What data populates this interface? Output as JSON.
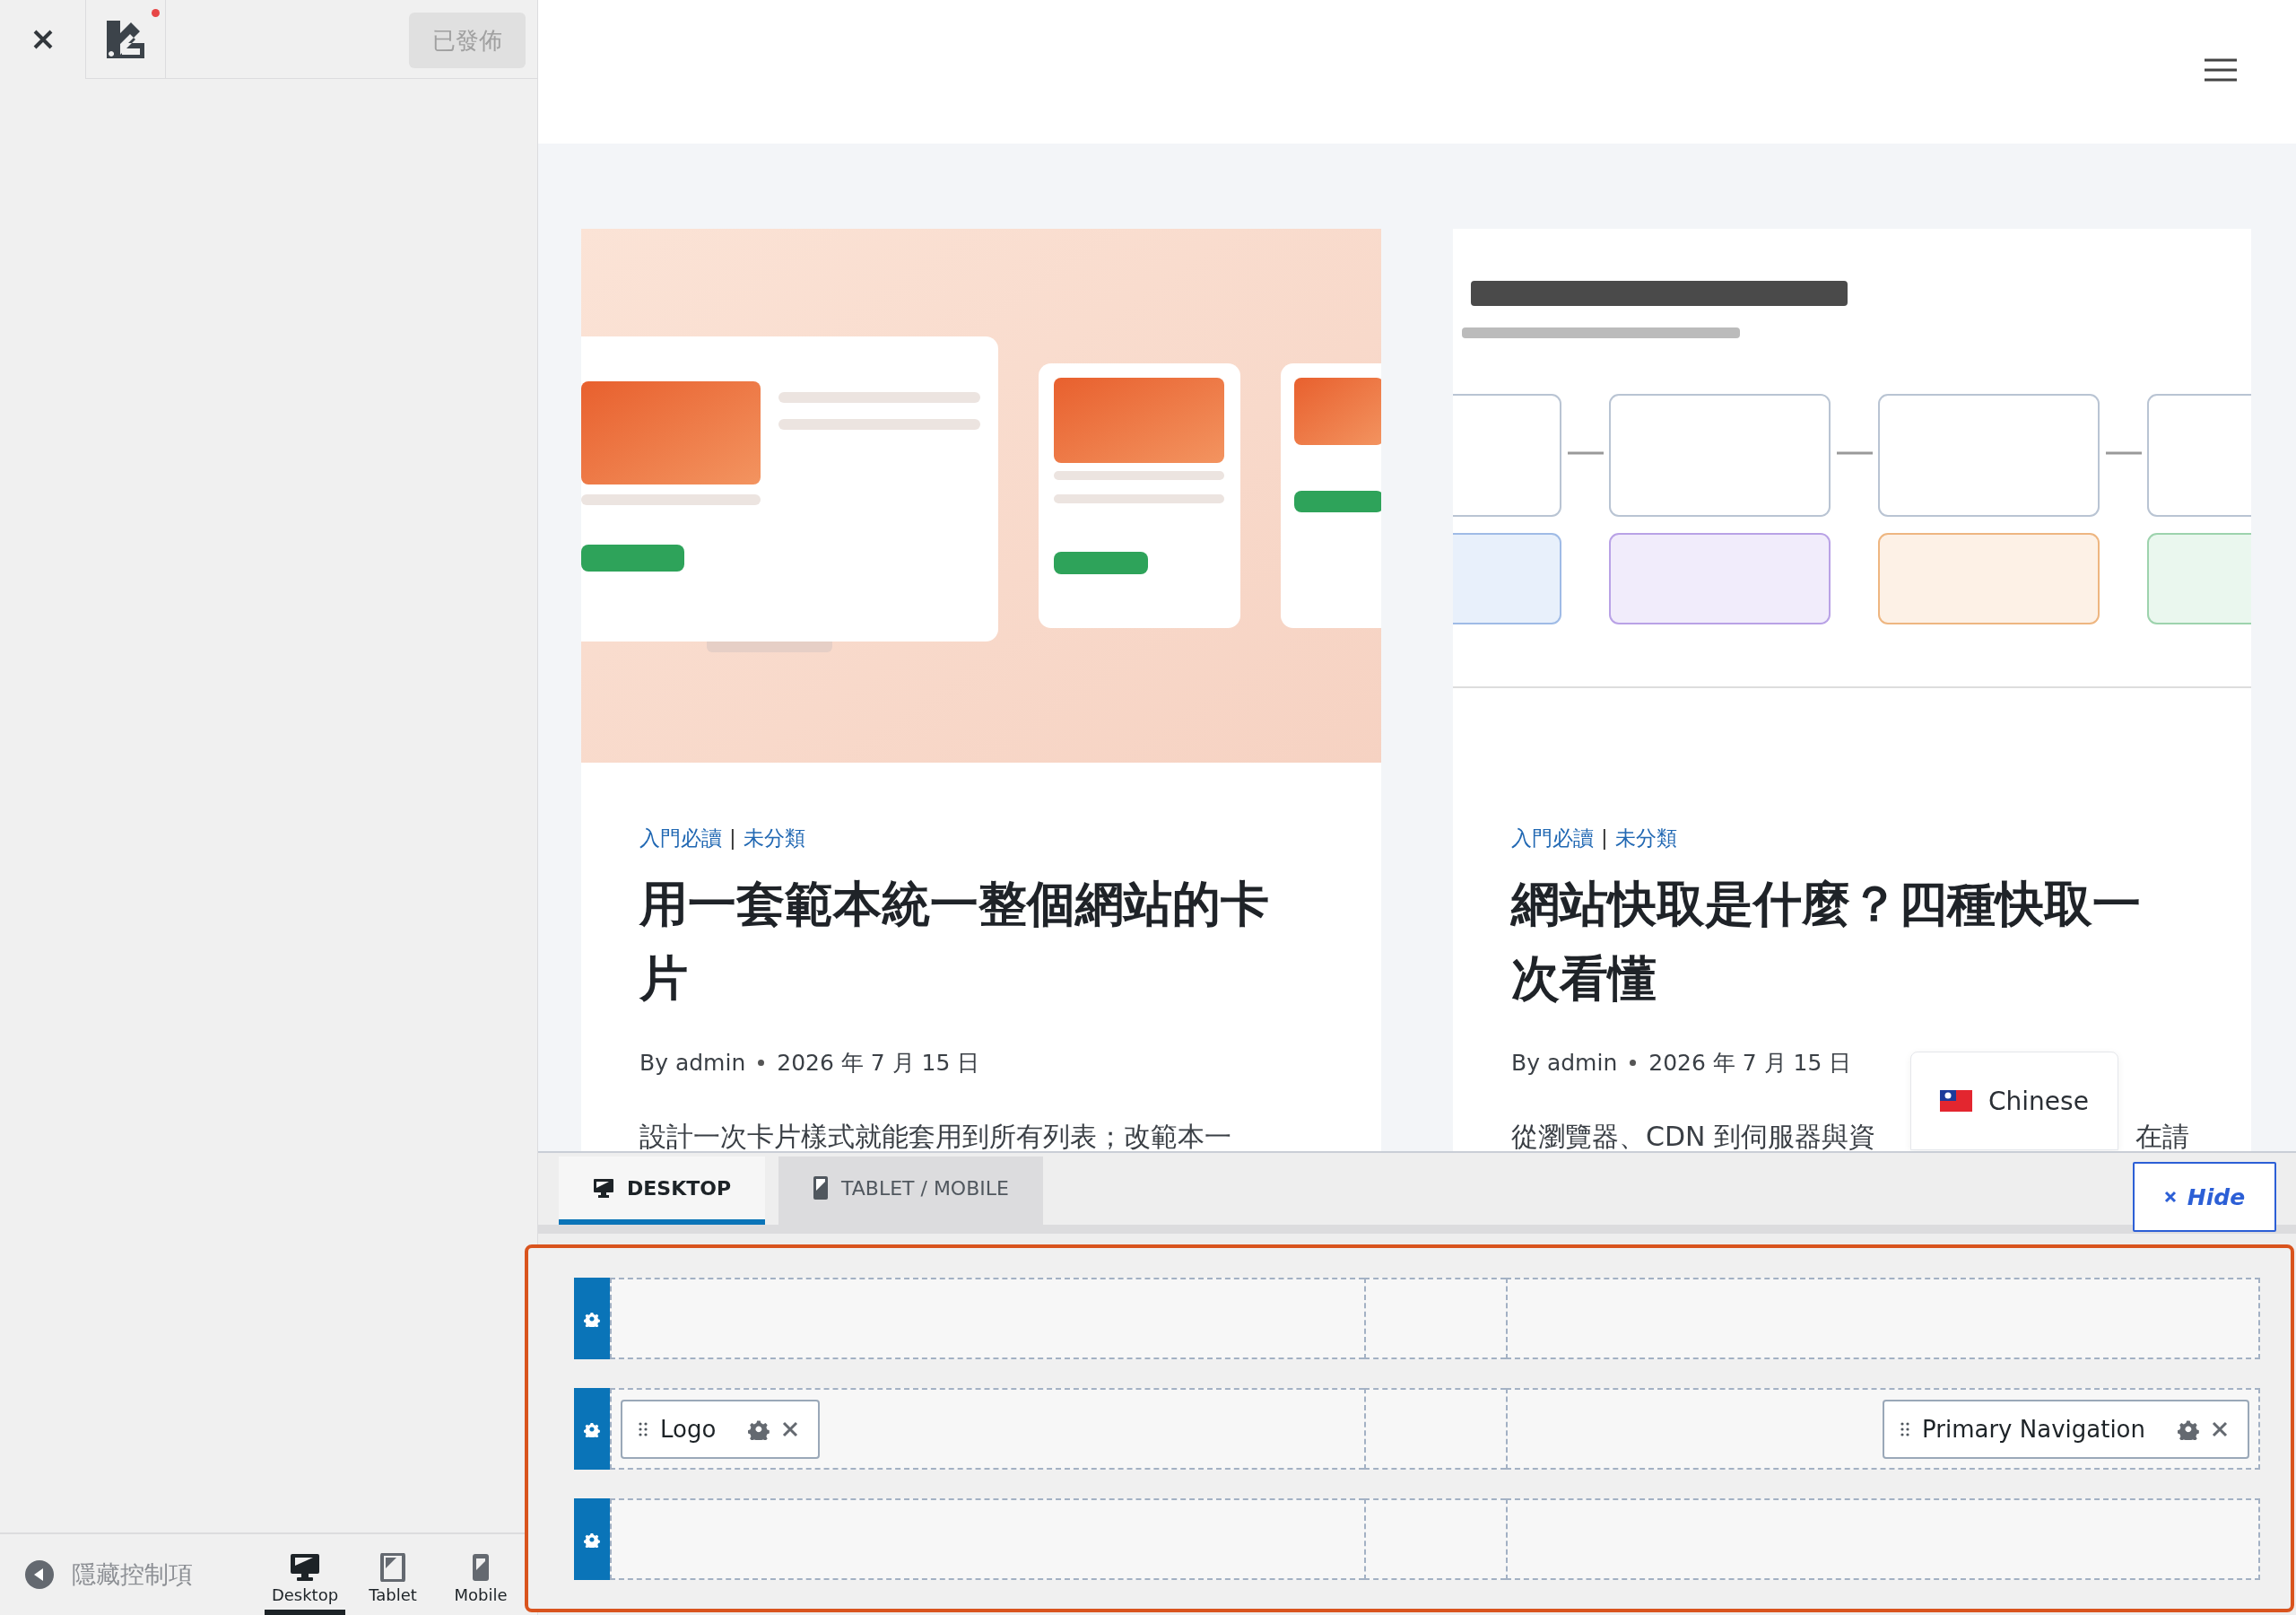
{
  "sidebar": {
    "notification": true,
    "publish_button": {
      "label": "已發佈",
      "disabled": true
    },
    "footer": {
      "hide_controls": "隱藏控制項",
      "devices": [
        {
          "label": "Desktop",
          "kind": "desktop",
          "selected": true
        },
        {
          "label": "Tablet",
          "kind": "tablet",
          "selected": false
        },
        {
          "label": "Mobile",
          "kind": "mobile",
          "selected": false
        }
      ]
    }
  },
  "posts": [
    {
      "image": {
        "kind": "picture"
      },
      "categories": [
        "入門必讀",
        "未分類"
      ],
      "separator": "|",
      "title": "用一套範本統一整個網站的卡片",
      "author": "By admin",
      "date": "2026 年 7 月 15 日",
      "excerpt": "設計一次卡片樣式就能套用到所有列表；改範本一"
    },
    {
      "image": {
        "kind": "picture"
      },
      "categories": [
        "入門必讀",
        "未分類"
      ],
      "separator": "|",
      "title": "網站快取是什麼？四種快取一次看懂",
      "author": "By admin",
      "date": "2026 年 7 月 15 日",
      "excerpt": "從瀏覽器、CDN 到伺服器與資",
      "excerpt_after": "在請"
    }
  ],
  "language_popup": {
    "label": "Chinese"
  },
  "header_builder": {
    "tabs": [
      {
        "label": "DESKTOP",
        "kind": "desktop",
        "selected": true
      },
      {
        "label": "TABLET / MOBILE",
        "kind": "mobile",
        "selected": false
      }
    ],
    "hide_button": "Hide",
    "rows": [
      {
        "left": [],
        "right": []
      },
      {
        "left": [
          {
            "label": "Logo"
          }
        ],
        "right": [
          {
            "label": "Primary Navigation"
          }
        ]
      },
      {
        "left": [],
        "right": []
      }
    ]
  }
}
